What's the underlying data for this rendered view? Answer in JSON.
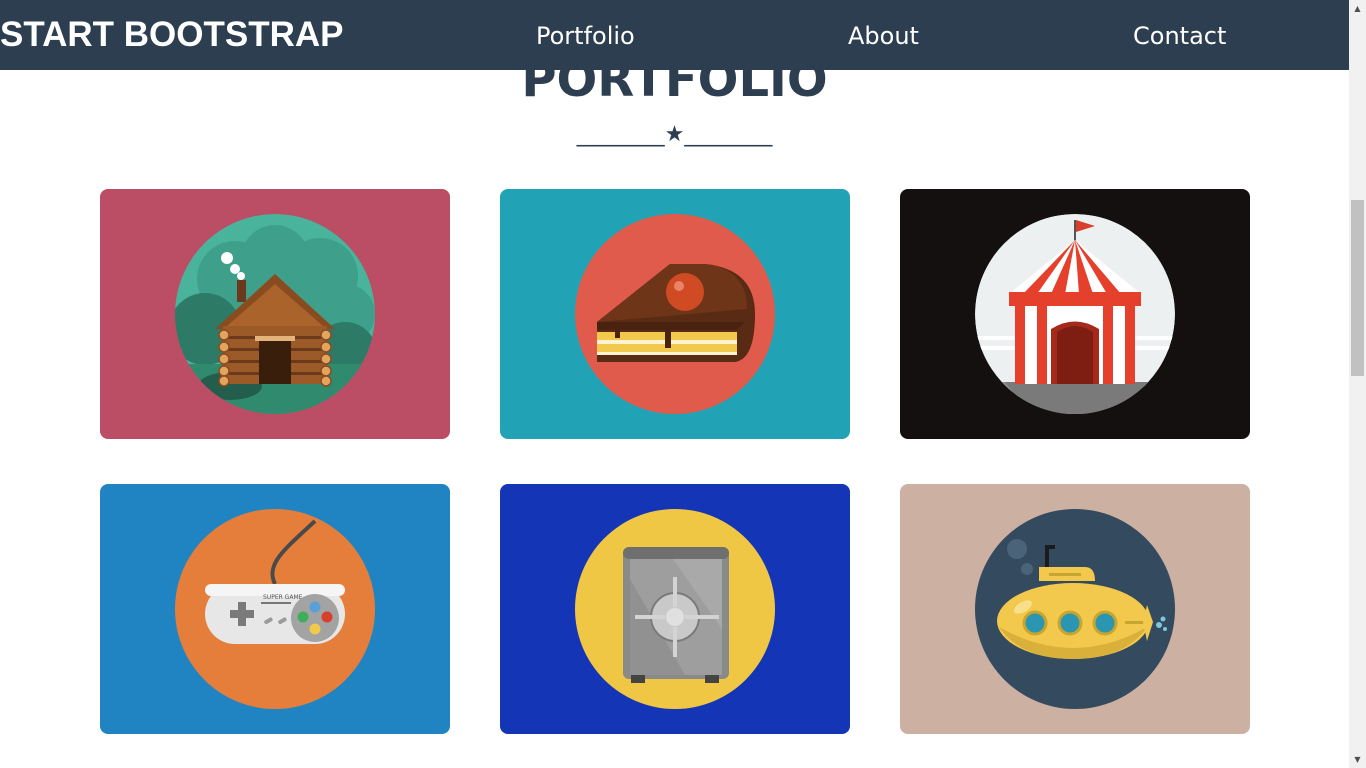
{
  "navbar": {
    "brand": "START BOOTSTRAP",
    "links": [
      "Portfolio",
      "About",
      "Contact"
    ],
    "background": "#2c3e50"
  },
  "portfolio": {
    "title": "PORTFOLIO",
    "divider": "________★________",
    "items": [
      {
        "icon": "cabin-icon",
        "background": "#bb4d64"
      },
      {
        "icon": "cake-icon",
        "background": "#21a3b5"
      },
      {
        "icon": "circus-tent-icon",
        "background": "#141010"
      },
      {
        "icon": "game-controller-icon",
        "background": "#2184c2"
      },
      {
        "icon": "safe-icon",
        "background": "#1435b5"
      },
      {
        "icon": "submarine-icon",
        "background": "#ccb1a3"
      }
    ],
    "controller_text": "SUPER GAME"
  },
  "colors": {
    "text_dark": "#2c3e50",
    "white": "#ffffff"
  }
}
